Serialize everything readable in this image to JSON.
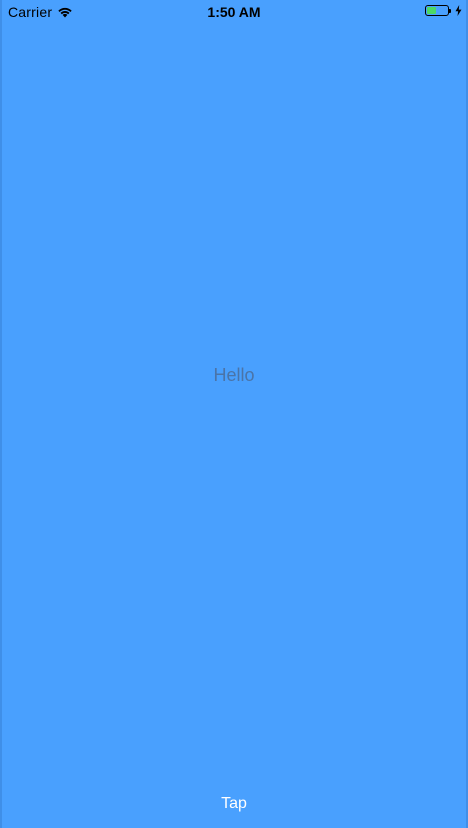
{
  "status_bar": {
    "carrier": "Carrier",
    "time": "1:50 AM",
    "battery_level": 0.45,
    "icons": [
      "wifi-icon",
      "battery-icon",
      "charging-bolt-icon"
    ],
    "battery_fill_color": "#4cd964"
  },
  "main": {
    "label": "Hello",
    "background_color": "#49a0fe"
  },
  "footer": {
    "tap_label": "Tap"
  }
}
